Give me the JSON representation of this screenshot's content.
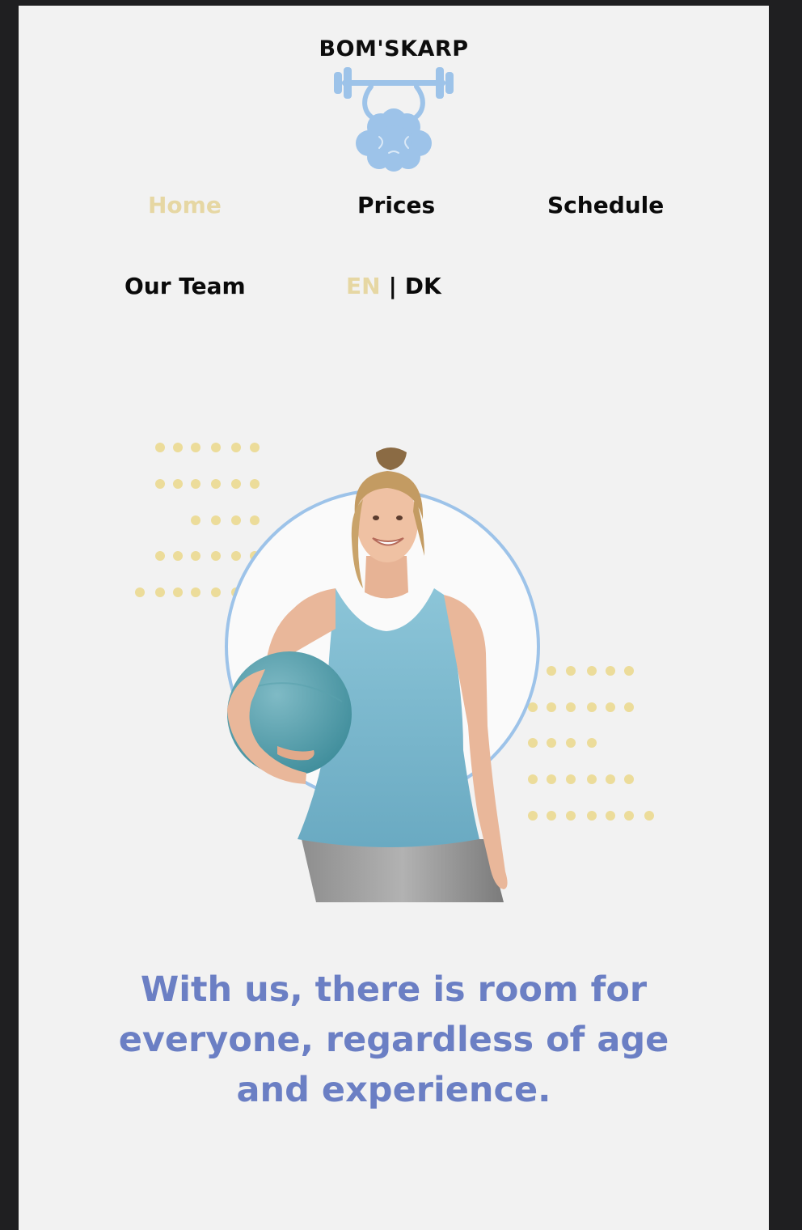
{
  "header": {
    "brand_name": "BOM'SKARP",
    "logo_icon": "barbell-brain-icon"
  },
  "nav": {
    "items": [
      {
        "label": "Home",
        "active": true
      },
      {
        "label": "Prices",
        "active": false
      },
      {
        "label": "Schedule",
        "active": false
      },
      {
        "label": "Our Team",
        "active": false
      }
    ],
    "language": {
      "en": "EN",
      "separator": "|",
      "dk": "DK",
      "active": "EN"
    }
  },
  "hero": {
    "image": "woman-holding-fitness-ball-illustration",
    "tagline": "With us, there is room for everyone, regardless of age and experience."
  },
  "colors": {
    "accent_gold": "#e6d7a3",
    "accent_blue": "#9dc3e9",
    "tagline_blue": "#6b7fc4",
    "page_bg": "#f2f2f2",
    "frame_bg": "#1f1f21"
  }
}
